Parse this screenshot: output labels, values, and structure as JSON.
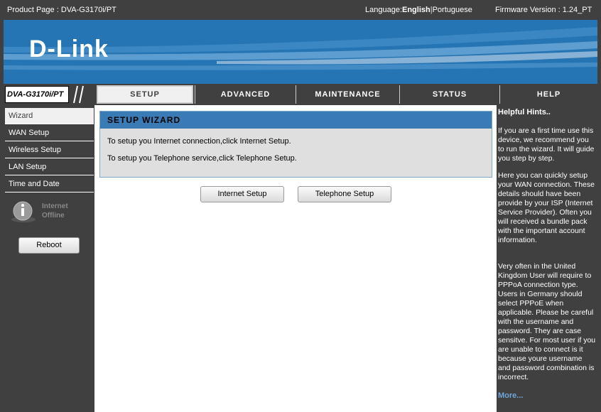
{
  "topbar": {
    "product": "Product Page : DVA-G3170i/PT",
    "language_label": "Language:",
    "language_current": "English",
    "language_sep": "|",
    "language_alt": "Portuguese",
    "firmware": "Firmware Version : 1.24_PT"
  },
  "banner": {
    "logo": "D-Link"
  },
  "nav": {
    "model": "DVA-G3170i/PT",
    "tabs": [
      {
        "label": "SETUP",
        "active": true
      },
      {
        "label": "ADVANCED"
      },
      {
        "label": "MAINTENANCE"
      },
      {
        "label": "STATUS"
      },
      {
        "label": "HELP"
      }
    ]
  },
  "sidebar": {
    "items": [
      {
        "label": "Wizard",
        "active": true
      },
      {
        "label": "WAN Setup"
      },
      {
        "label": "Wireless Setup"
      },
      {
        "label": "LAN Setup"
      },
      {
        "label": "Time and Date"
      }
    ],
    "status_line1": "Internet",
    "status_line2": "Offline",
    "status_icon": "info-icon",
    "reboot_label": "Reboot"
  },
  "main": {
    "title": "SETUP WIZARD",
    "line1": "To setup you Internet connection,click Internet Setup.",
    "line2": "To setup you Telephone service,click Telephone Setup.",
    "internet_button": "Internet Setup",
    "telephone_button": "Telephone Setup"
  },
  "help": {
    "title": "Helpful Hints..",
    "p1": "If you are a first time use this device, we recommend you to run the wizard. It will guide you step by step.",
    "p2": "Here you can quickly setup your WAN connection. These details should have been provide by your ISP (Internet Service Provider). Often you will received a bundle pack with the important account information.",
    "p3": "Very often in the United Kingdom User will require to PPPoA connection type. Users in Germany should select PPPoE when applicable. Please be careful with the username and password. They are case sensitve. For most user if you are unable to connect is it because youre username and password combination is incorrect.",
    "more": "More..."
  },
  "colors": {
    "dark_gray": "#404040",
    "banner_blue": "#2574b3",
    "header_blue": "#3a7ab5",
    "link_blue": "#6ea7dc"
  }
}
